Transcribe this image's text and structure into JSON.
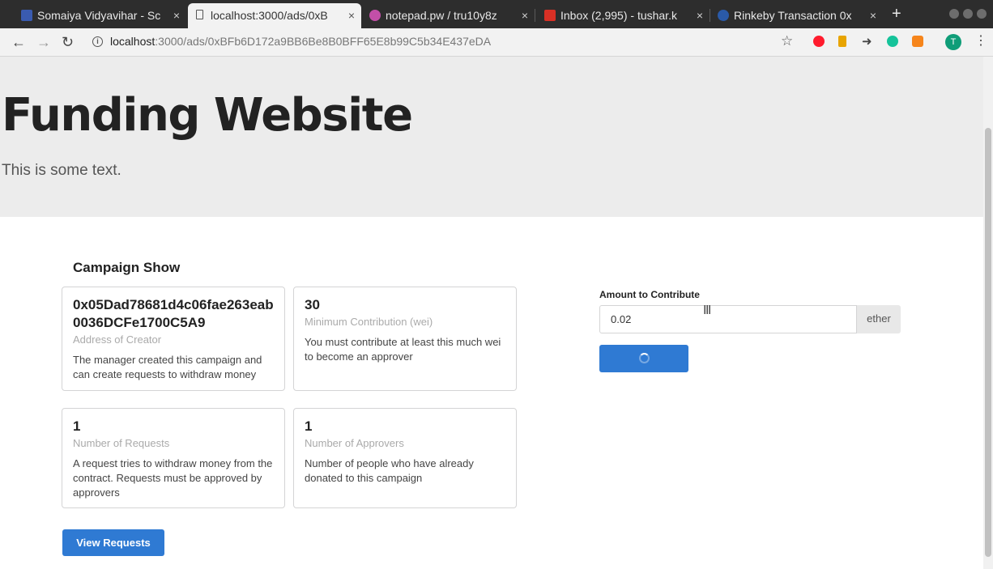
{
  "browser": {
    "tabs": [
      {
        "title": "Somaiya Vidyavihar - Sc",
        "favicon": "somaiya-favicon",
        "close": "×"
      },
      {
        "title": "localhost:3000/ads/0xB",
        "favicon": "document-icon",
        "close": "×"
      },
      {
        "title": "notepad.pw / tru10y8z",
        "favicon": "notepad-favicon",
        "close": "×"
      },
      {
        "title": "Inbox (2,995) - tushar.k",
        "favicon": "gmail-icon",
        "close": "×"
      },
      {
        "title": "Rinkeby Transaction 0x",
        "favicon": "etherscan-icon",
        "close": "×"
      }
    ],
    "new_tab": "+",
    "url_host": "localhost",
    "url_rest": ":3000/ads/0xBFb6D172a9BB6Be8B0BFF65E8b99C5b34E437eDA",
    "profile_initial": "T"
  },
  "page": {
    "title": "Funding Website",
    "subtitle": "This is some text."
  },
  "campaign": {
    "heading": "Campaign Show",
    "cards": [
      {
        "value": "0x05Dad78681d4c06fae263eab0036DCFe1700C5A9",
        "meta": "Address of Creator",
        "desc": "The manager created this campaign and can create requests to withdraw money"
      },
      {
        "value": "30",
        "meta": "Minimum Contribution (wei)",
        "desc": "You must contribute at least this much wei to become an approver"
      },
      {
        "value": "1",
        "meta": "Number of Requests",
        "desc": "A request tries to withdraw money from the contract. Requests must be approved by approvers"
      },
      {
        "value": "1",
        "meta": "Number of Approvers",
        "desc": "Number of people who have already donated to this campaign"
      }
    ],
    "view_requests_label": "View Requests"
  },
  "contribute": {
    "label": "Amount to Contribute",
    "amount": "0.02",
    "unit": "ether",
    "button_state": "loading"
  },
  "colors": {
    "primary_button": "#2f7ad3",
    "jumbotron_bg": "#ececec"
  }
}
